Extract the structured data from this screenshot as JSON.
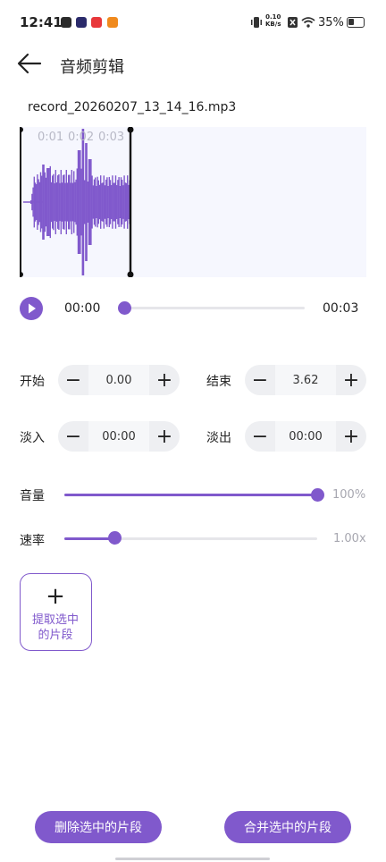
{
  "status_bar": {
    "time": "12:41",
    "speed_value": "0.10",
    "speed_unit": "KB/s",
    "battery_percent": "35%",
    "app_icon_colors": [
      "#2b2b2b",
      "#2b2b6b",
      "#e8373a",
      "#f08a1d"
    ]
  },
  "header": {
    "title": "音频剪辑",
    "back_icon": "arrow-left-icon"
  },
  "file": {
    "name": "record_20260207_13_14_16.mp3"
  },
  "waveform": {
    "ticks": [
      "0:01",
      "0:02",
      "0:03"
    ],
    "wave_color": "#8059cc",
    "bg_color": "#f6f7fe"
  },
  "player": {
    "current_time": "00:00",
    "total_time": "00:03",
    "progress": 0.0,
    "play_icon": "play-icon"
  },
  "trim": {
    "start_label": "开始",
    "start_value": "0.00",
    "end_label": "结束",
    "end_value": "3.62",
    "fade_in_label": "淡入",
    "fade_in_value": "00:00",
    "fade_out_label": "淡出",
    "fade_out_value": "00:00",
    "minus_symbol": "−",
    "plus_symbol": "+"
  },
  "volume": {
    "label": "音量",
    "value_text": "100%",
    "level": 1.0
  },
  "rate": {
    "label": "速率",
    "value_text": "1.00x",
    "level": 0.2
  },
  "extract": {
    "plus": "+",
    "label_line1": "提取选中",
    "label_line2": "的片段"
  },
  "actions": {
    "delete_label": "删除选中的片段",
    "merge_label": "合并选中的片段"
  },
  "theme": {
    "accent": "#8059cc"
  }
}
